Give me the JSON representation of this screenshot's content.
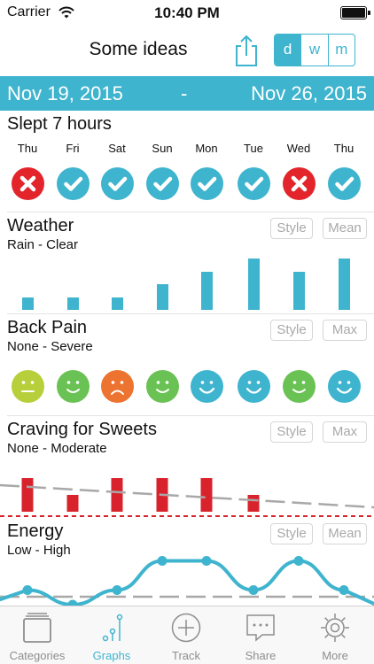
{
  "status_bar": {
    "carrier": "Carrier",
    "time": "10:40 PM"
  },
  "nav": {
    "title": "Some ideas",
    "segments": [
      "d",
      "w",
      "m"
    ],
    "selected_segment": "d"
  },
  "date_range": {
    "start": "Nov 19, 2015",
    "separator": "-",
    "end": "Nov 26, 2015"
  },
  "colors": {
    "accent": "#3fb4ce",
    "fail": "#e3242b",
    "success": "#3fb4ce",
    "bar_red": "#d9232c",
    "face_yellow": "#b7cf3b",
    "face_green": "#69c253",
    "face_orange": "#ec7330",
    "face_blue": "#3fb4ce"
  },
  "days": [
    "Thu",
    "Fri",
    "Sat",
    "Sun",
    "Mon",
    "Tue",
    "Wed",
    "Thu"
  ],
  "sections": {
    "sleep": {
      "title": "Slept 7 hours",
      "results": [
        "fail",
        "success",
        "success",
        "success",
        "success",
        "success",
        "fail",
        "success"
      ]
    },
    "weather": {
      "title": "Weather",
      "range": "Rain - Clear",
      "style_label": "Style",
      "mode_label": "Mean",
      "levels": [
        0.25,
        0.25,
        0.25,
        0.5,
        0.75,
        1.0,
        0.75,
        1.0
      ]
    },
    "back_pain": {
      "title": "Back Pain",
      "range": "None - Severe",
      "style_label": "Style",
      "mode_label": "Max",
      "faces": [
        "neutral",
        "happy",
        "sad",
        "happy",
        "very-happy",
        "very-happy",
        "happy",
        "very-happy"
      ]
    },
    "craving": {
      "title": "Craving for Sweets",
      "range": "None - Moderate",
      "style_label": "Style",
      "mode_label": "Max",
      "levels": [
        1.0,
        0.5,
        1.0,
        1.0,
        1.0,
        0.5,
        0,
        0
      ]
    },
    "energy": {
      "title": "Energy",
      "range": "Low - High",
      "style_label": "Style",
      "mode_label": "Mean",
      "levels": [
        0.25,
        0,
        0.25,
        0.75,
        0.75,
        0.25,
        0.75,
        0.25
      ]
    }
  },
  "tabs": [
    {
      "label": "Categories",
      "icon": "folder-icon",
      "active": false
    },
    {
      "label": "Graphs",
      "icon": "graph-icon",
      "active": true
    },
    {
      "label": "Track",
      "icon": "plus-circle-icon",
      "active": false
    },
    {
      "label": "Share",
      "icon": "speech-bubble-icon",
      "active": false
    },
    {
      "label": "More",
      "icon": "gear-icon",
      "active": false
    }
  ]
}
